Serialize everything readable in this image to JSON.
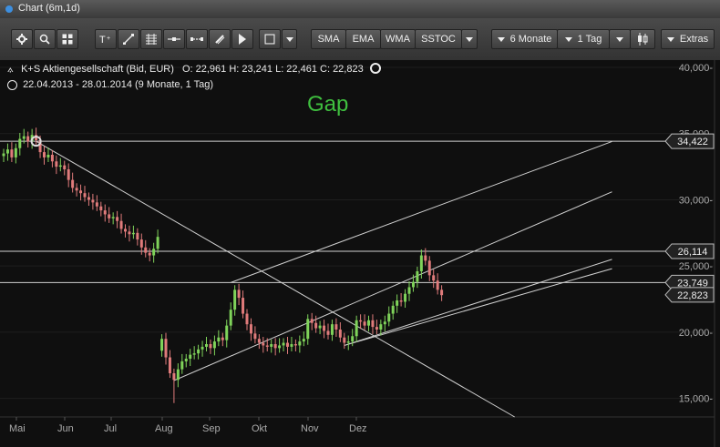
{
  "window": {
    "title": "Chart (6m,1d)"
  },
  "toolbar": {
    "indicators": [
      "SMA",
      "EMA",
      "WMA",
      "SSTOC"
    ],
    "range": "6 Monate",
    "interval": "1 Tag",
    "extras": "Extras"
  },
  "legend": {
    "instrument": "K+S Aktiengesellschaft (Bid, EUR)",
    "ohlc": "O: 22,961  H: 23,241  L: 22,461  C: 22,823",
    "period": "22.04.2013 - 28.01.2014 (9 Monate, 1 Tag)"
  },
  "colors": {
    "up": "#7fd35a",
    "down": "#e07b7b",
    "annotation": "#3fbf3f",
    "lines": "#d0d0d0"
  },
  "chart_data": {
    "type": "candlestick",
    "annotation": "Gap",
    "x_tick_labels": [
      "Mai",
      "Jun",
      "Jul",
      "Aug",
      "Sep",
      "Okt",
      "Nov",
      "Dez"
    ],
    "y_tick_labels": [
      "15,000-",
      "20,000-",
      "25,000-",
      "30,000-",
      "35,000-",
      "40,000-"
    ],
    "y_ticks": [
      15,
      20,
      25,
      30,
      35,
      40
    ],
    "y_range": [
      13.6,
      40.0
    ],
    "price_labels": [
      "34,422",
      "26,114",
      "23,749",
      "22,823"
    ],
    "price_levels": [
      34.422,
      26.114,
      23.749,
      22.823
    ],
    "series": [
      {
        "x": 0,
        "y": 33.5
      },
      {
        "x": 1,
        "y": 33.8
      },
      {
        "x": 2,
        "y": 33.2
      },
      {
        "x": 3,
        "y": 33.9
      },
      {
        "x": 4,
        "y": 34.6
      },
      {
        "x": 5,
        "y": 34.8
      },
      {
        "x": 6,
        "y": 34.4
      },
      {
        "x": 7,
        "y": 34.9
      },
      {
        "x": 8,
        "y": 34.5
      },
      {
        "x": 9,
        "y": 33.6
      },
      {
        "x": 10,
        "y": 33.2
      },
      {
        "x": 11,
        "y": 33.4
      },
      {
        "x": 12,
        "y": 32.9
      },
      {
        "x": 13,
        "y": 32.5
      },
      {
        "x": 14,
        "y": 32.6
      },
      {
        "x": 15,
        "y": 32.3
      },
      {
        "x": 16,
        "y": 31.5
      },
      {
        "x": 17,
        "y": 30.9
      },
      {
        "x": 18,
        "y": 30.7
      },
      {
        "x": 19,
        "y": 30.5
      },
      {
        "x": 20,
        "y": 30.2
      },
      {
        "x": 21,
        "y": 30.0
      },
      {
        "x": 22,
        "y": 29.8
      },
      {
        "x": 23,
        "y": 29.5
      },
      {
        "x": 24,
        "y": 29.2
      },
      {
        "x": 25,
        "y": 28.9
      },
      {
        "x": 26,
        "y": 28.6
      },
      {
        "x": 27,
        "y": 28.7
      },
      {
        "x": 28,
        "y": 28.4
      },
      {
        "x": 29,
        "y": 27.8
      },
      {
        "x": 30,
        "y": 27.6
      },
      {
        "x": 31,
        "y": 27.4
      },
      {
        "x": 32,
        "y": 27.5
      },
      {
        "x": 33,
        "y": 27.0
      },
      {
        "x": 34,
        "y": 26.4
      },
      {
        "x": 35,
        "y": 26.0
      },
      {
        "x": 36,
        "y": 25.8
      },
      {
        "x": 37,
        "y": 26.3
      },
      {
        "x": 38,
        "y": 27.2
      },
      {
        "x": 39,
        "y": 19.5
      },
      {
        "x": 40,
        "y": 18.1
      },
      {
        "x": 41,
        "y": 16.9
      },
      {
        "x": 42,
        "y": 16.4
      },
      {
        "x": 43,
        "y": 17.2
      },
      {
        "x": 44,
        "y": 17.8
      },
      {
        "x": 45,
        "y": 18.0
      },
      {
        "x": 46,
        "y": 18.3
      },
      {
        "x": 47,
        "y": 18.4
      },
      {
        "x": 48,
        "y": 18.7
      },
      {
        "x": 49,
        "y": 18.9
      },
      {
        "x": 50,
        "y": 19.1
      },
      {
        "x": 51,
        "y": 18.8
      },
      {
        "x": 52,
        "y": 19.3
      },
      {
        "x": 53,
        "y": 19.6
      },
      {
        "x": 54,
        "y": 19.4
      },
      {
        "x": 55,
        "y": 20.5
      },
      {
        "x": 56,
        "y": 21.7
      },
      {
        "x": 57,
        "y": 23.2
      },
      {
        "x": 58,
        "y": 22.6
      },
      {
        "x": 59,
        "y": 21.4
      },
      {
        "x": 60,
        "y": 20.6
      },
      {
        "x": 61,
        "y": 19.9
      },
      {
        "x": 62,
        "y": 19.5
      },
      {
        "x": 63,
        "y": 19.2
      },
      {
        "x": 64,
        "y": 19.0
      },
      {
        "x": 65,
        "y": 18.9
      },
      {
        "x": 66,
        "y": 19.1
      },
      {
        "x": 67,
        "y": 18.8
      },
      {
        "x": 68,
        "y": 19.0
      },
      {
        "x": 69,
        "y": 19.2
      },
      {
        "x": 70,
        "y": 18.9
      },
      {
        "x": 71,
        "y": 19.1
      },
      {
        "x": 72,
        "y": 19.0
      },
      {
        "x": 73,
        "y": 19.3
      },
      {
        "x": 74,
        "y": 19.5
      },
      {
        "x": 75,
        "y": 21.0
      },
      {
        "x": 76,
        "y": 20.7
      },
      {
        "x": 77,
        "y": 20.3
      },
      {
        "x": 78,
        "y": 20.5
      },
      {
        "x": 79,
        "y": 20.1
      },
      {
        "x": 80,
        "y": 19.8
      },
      {
        "x": 81,
        "y": 20.6
      },
      {
        "x": 82,
        "y": 20.2
      },
      {
        "x": 83,
        "y": 19.6
      },
      {
        "x": 84,
        "y": 19.2
      },
      {
        "x": 85,
        "y": 19.3
      },
      {
        "x": 86,
        "y": 19.7
      },
      {
        "x": 87,
        "y": 20.9
      },
      {
        "x": 88,
        "y": 20.8
      },
      {
        "x": 89,
        "y": 20.5
      },
      {
        "x": 90,
        "y": 20.9
      },
      {
        "x": 91,
        "y": 20.4
      },
      {
        "x": 92,
        "y": 20.2
      },
      {
        "x": 93,
        "y": 20.6
      },
      {
        "x": 94,
        "y": 20.8
      },
      {
        "x": 95,
        "y": 21.4
      },
      {
        "x": 96,
        "y": 22.0
      },
      {
        "x": 97,
        "y": 22.4
      },
      {
        "x": 98,
        "y": 22.3
      },
      {
        "x": 99,
        "y": 22.9
      },
      {
        "x": 100,
        "y": 23.4
      },
      {
        "x": 101,
        "y": 23.8
      },
      {
        "x": 102,
        "y": 24.6
      },
      {
        "x": 103,
        "y": 25.8
      },
      {
        "x": 104,
        "y": 25.4
      },
      {
        "x": 105,
        "y": 24.3
      },
      {
        "x": 106,
        "y": 23.9
      },
      {
        "x": 107,
        "y": 23.2
      },
      {
        "x": 108,
        "y": 22.8
      }
    ],
    "trend_lines": [
      {
        "x1": 8,
        "y1": 34.422,
        "x2": 126,
        "y2": 13.6
      },
      {
        "x1": 42,
        "y1": 16.35,
        "x2": 150,
        "y2": 30.6
      },
      {
        "x1": 56,
        "y1": 23.75,
        "x2": 150,
        "y2": 34.4
      },
      {
        "x1": 84,
        "y1": 19.0,
        "x2": 150,
        "y2": 24.8
      },
      {
        "x1": 84,
        "y1": 19.0,
        "x2": 150,
        "y2": 25.5
      }
    ]
  }
}
